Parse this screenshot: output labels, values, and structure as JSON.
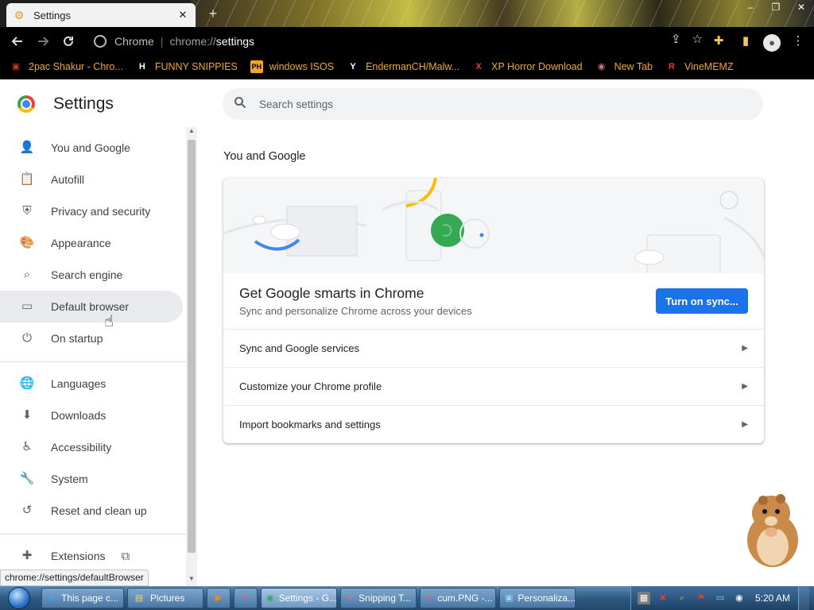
{
  "tab": {
    "title": "Settings",
    "favicon": "gear-icon"
  },
  "window_controls": [
    "–",
    "❐",
    "✕"
  ],
  "toolbar": {
    "site_chip": "Chrome",
    "url_prefix": "chrome://",
    "url_host": "settings"
  },
  "bookmarks": [
    {
      "label": "2pac Shakur - Chro...",
      "icon": "photo",
      "icon_text": "▣",
      "color": "#c0392b"
    },
    {
      "label": "FUNNY SNIPPIES",
      "icon": "H",
      "icon_text": "H",
      "color": "#ffffff"
    },
    {
      "label": "windows ISOS",
      "icon": "PH",
      "icon_text": "PH",
      "color": "#f5a623"
    },
    {
      "label": "EndermanCH/Malw...",
      "icon": "YP",
      "icon_text": "Y",
      "color": "#ffffff"
    },
    {
      "label": "XP Horror Download",
      "icon": "X",
      "icon_text": "X",
      "color": "#e53935"
    },
    {
      "label": "New Tab",
      "icon": "globe",
      "icon_text": "◉",
      "color": "#d46a9c"
    },
    {
      "label": "VineMEMZ",
      "icon": "R",
      "icon_text": "R",
      "color": "#e53935"
    }
  ],
  "settings": {
    "title": "Settings",
    "search_placeholder": "Search settings"
  },
  "sidebar": {
    "items": [
      {
        "label": "You and Google",
        "icon": "person-icon"
      },
      {
        "label": "Autofill",
        "icon": "clipboard-icon"
      },
      {
        "label": "Privacy and security",
        "icon": "shield-icon"
      },
      {
        "label": "Appearance",
        "icon": "palette-icon"
      },
      {
        "label": "Search engine",
        "icon": "search-icon"
      },
      {
        "label": "Default browser",
        "icon": "browser-icon",
        "active": true
      },
      {
        "label": "On startup",
        "icon": "power-icon"
      },
      {
        "label": "Languages",
        "icon": "globe-icon"
      },
      {
        "label": "Downloads",
        "icon": "download-icon"
      },
      {
        "label": "Accessibility",
        "icon": "accessibility-icon"
      },
      {
        "label": "System",
        "icon": "wrench-icon"
      },
      {
        "label": "Reset and clean up",
        "icon": "history-icon"
      },
      {
        "label": "Extensions",
        "icon": "puzzle-icon"
      }
    ]
  },
  "main": {
    "section_title": "You and Google",
    "promo": {
      "title": "Get Google smarts in Chrome",
      "subtitle": "Sync and personalize Chrome across your devices",
      "button": "Turn on sync..."
    },
    "rows": [
      "Sync and Google services",
      "Customize your Chrome profile",
      "Import bookmarks and settings"
    ]
  },
  "status_bar": "chrome://settings/defaultBrowser",
  "taskbar": {
    "tasks": [
      {
        "label": "This page c...",
        "icon": "ie-icon"
      },
      {
        "label": "Pictures",
        "icon": "folder-icon"
      },
      {
        "label": "",
        "icon": "media-player-icon"
      },
      {
        "label": "",
        "icon": "paint-icon"
      },
      {
        "label": "Settings - G...",
        "icon": "chrome-icon"
      },
      {
        "label": "Snipping T...",
        "icon": "scissors-icon"
      },
      {
        "label": "cum.PNG -...",
        "icon": "paint-icon"
      },
      {
        "label": "Personaliza...",
        "icon": "monitor-icon"
      }
    ],
    "clock": "5:20 AM"
  },
  "colors": {
    "accent": "#1a73e8",
    "bookmark_text": "#f5a623",
    "active_nav": "#e8eaed"
  }
}
